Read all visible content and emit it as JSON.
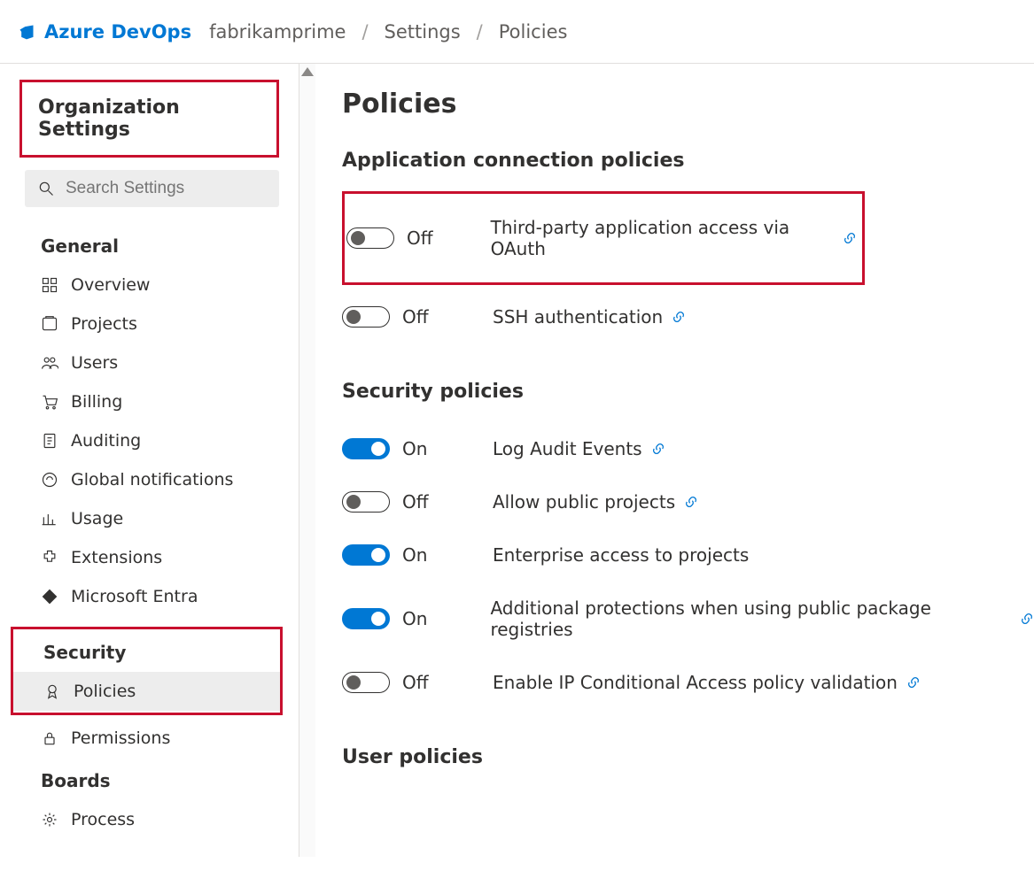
{
  "header": {
    "brand": "Azure DevOps",
    "crumbs": [
      "fabrikamprime",
      "Settings",
      "Policies"
    ]
  },
  "sidebar": {
    "title": "Organization Settings",
    "search_placeholder": "Search Settings",
    "sections": [
      {
        "title": "General",
        "items": [
          {
            "id": "overview",
            "label": "Overview"
          },
          {
            "id": "projects",
            "label": "Projects"
          },
          {
            "id": "users",
            "label": "Users"
          },
          {
            "id": "billing",
            "label": "Billing"
          },
          {
            "id": "auditing",
            "label": "Auditing"
          },
          {
            "id": "global-notifications",
            "label": "Global notifications"
          },
          {
            "id": "usage",
            "label": "Usage"
          },
          {
            "id": "extensions",
            "label": "Extensions"
          },
          {
            "id": "microsoft-entra",
            "label": "Microsoft Entra"
          }
        ]
      },
      {
        "title": "Security",
        "items": [
          {
            "id": "policies",
            "label": "Policies",
            "selected": true
          },
          {
            "id": "permissions",
            "label": "Permissions"
          }
        ]
      },
      {
        "title": "Boards",
        "items": [
          {
            "id": "process",
            "label": "Process"
          }
        ]
      }
    ]
  },
  "main": {
    "page_title": "Policies",
    "groups": [
      {
        "heading": "Application connection policies",
        "items": [
          {
            "on": false,
            "state": "Off",
            "label": "Third-party application access via OAuth",
            "link": true,
            "highlighted": true
          },
          {
            "on": false,
            "state": "Off",
            "label": "SSH authentication",
            "link": true
          }
        ]
      },
      {
        "heading": "Security policies",
        "items": [
          {
            "on": true,
            "state": "On",
            "label": "Log Audit Events",
            "link": true
          },
          {
            "on": false,
            "state": "Off",
            "label": "Allow public projects",
            "link": true
          },
          {
            "on": true,
            "state": "On",
            "label": "Enterprise access to projects",
            "link": false
          },
          {
            "on": true,
            "state": "On",
            "label": "Additional protections when using public package registries",
            "link": true
          },
          {
            "on": false,
            "state": "Off",
            "label": "Enable IP Conditional Access policy validation",
            "link": true
          }
        ]
      },
      {
        "heading": "User policies",
        "items": []
      }
    ]
  }
}
